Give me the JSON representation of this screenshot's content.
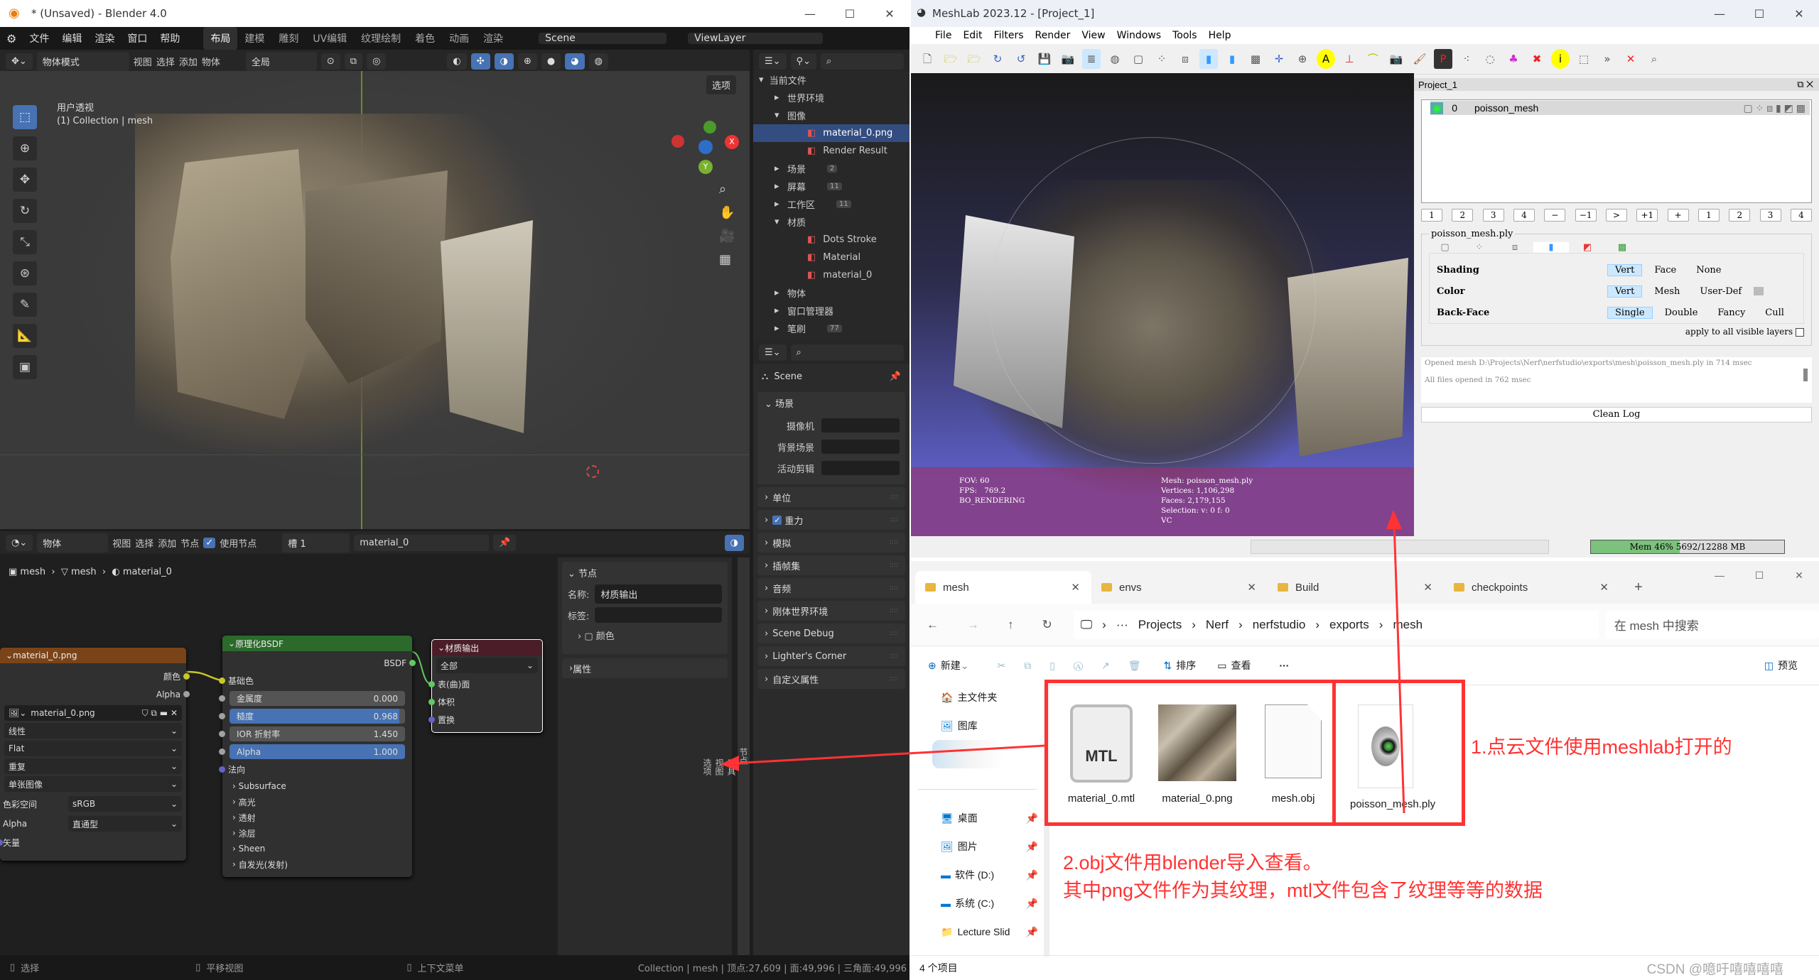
{
  "blender": {
    "title": "* (Unsaved) - Blender 4.0",
    "window_controls": [
      "—",
      "☐",
      "✕"
    ],
    "menu": [
      "文件",
      "编辑",
      "渲染",
      "窗口",
      "帮助"
    ],
    "workspaces": [
      "布局",
      "建模",
      "雕刻",
      "UV编辑",
      "纹理绘制",
      "着色",
      "动画",
      "渲染"
    ],
    "active_workspace": "布局",
    "scene": "Scene",
    "view_layer": "ViewLayer",
    "viewport_header": {
      "mode": "物体模式",
      "menus": [
        "视图",
        "选择",
        "添加",
        "物体"
      ],
      "orientation": "全局",
      "options": "选项"
    },
    "viewport_overlay": {
      "line1": "用户透视",
      "line2": "(1) Collection | mesh"
    },
    "outliner": {
      "root": "当前文件",
      "items": [
        {
          "label": "世界环境",
          "depth": 1,
          "expanded": false
        },
        {
          "label": "图像",
          "depth": 1,
          "expanded": true
        },
        {
          "label": "material_0.png",
          "depth": 2,
          "selected": true
        },
        {
          "label": "Render Result",
          "depth": 2
        },
        {
          "label": "场景",
          "depth": 1,
          "badge": "2"
        },
        {
          "label": "屏幕",
          "depth": 1,
          "badge": "11"
        },
        {
          "label": "工作区",
          "depth": 1,
          "badge": "11"
        },
        {
          "label": "材质",
          "depth": 1,
          "expanded": true
        },
        {
          "label": "Dots Stroke",
          "depth": 2
        },
        {
          "label": "Material",
          "depth": 2
        },
        {
          "label": "material_0",
          "depth": 2
        },
        {
          "label": "物体",
          "depth": 1
        },
        {
          "label": "窗口管理器",
          "depth": 1
        },
        {
          "label": "笔刷",
          "depth": 1,
          "badge": "77"
        }
      ]
    },
    "properties": {
      "context": "Scene",
      "scene_panel": "场景",
      "fields": [
        "摄像机",
        "背景场景",
        "活动剪辑"
      ],
      "panels": [
        "单位",
        "重力",
        "模拟",
        "插帧集",
        "音频",
        "刚体世界环境",
        "Scene Debug",
        "Lighter's Corner",
        "自定义属性"
      ],
      "gravity_checked": true
    },
    "node_header": {
      "type": "物体",
      "menus": [
        "视图",
        "选择",
        "添加",
        "节点"
      ],
      "use_nodes": "使用节点",
      "slot": "槽 1",
      "material": "material_0"
    },
    "breadcrumb": [
      "mesh",
      "mesh",
      "material_0"
    ],
    "image_node": {
      "title": "material_0.png",
      "outputs": [
        "颜色",
        "Alpha"
      ],
      "image": "material_0.png",
      "interp": "线性",
      "projection": "Flat",
      "extension": "重复",
      "source": "单张图像",
      "colorspace_label": "色彩空间",
      "colorspace": "sRGB",
      "alpha_label": "Alpha",
      "alpha": "直通型",
      "vector": "矢量"
    },
    "bsdf_node": {
      "title": "原理化BSDF",
      "output": "BSDF",
      "base_color": "基础色",
      "sliders": [
        {
          "label": "金属度",
          "value": "0.000",
          "fill": 0
        },
        {
          "label": "糙度",
          "value": "0.968",
          "fill": 0.968
        },
        {
          "label": "IOR 折射率",
          "value": "1.450",
          "fill": 0
        },
        {
          "label": "Alpha",
          "value": "1.000",
          "fill": 1
        }
      ],
      "normal": "法向",
      "subpanels": [
        "Subsurface",
        "高光",
        "透射",
        "涂层",
        "Sheen",
        "自发光(发射)"
      ]
    },
    "output_node": {
      "title": "材质输出",
      "target": "全部",
      "inputs": [
        "表(曲)面",
        "体积",
        "置换"
      ]
    },
    "node_sidebar": {
      "panel": "节点",
      "name_label": "名称:",
      "name": "材质输出",
      "label_label": "标签:",
      "color": "颜色",
      "props": "属性",
      "tabs": [
        "节点",
        "工具",
        "视图",
        "选项"
      ]
    },
    "status": {
      "select": "选择",
      "pan": "平移视图",
      "context": "上下文菜单",
      "stats": "Collection | mesh | 顶点:27,609 | 面:49,996 | 三角面:49,996"
    }
  },
  "meshlab": {
    "title": "MeshLab 2023.12 - [Project_1]",
    "menu": [
      "File",
      "Edit",
      "Filters",
      "Render",
      "View",
      "Windows",
      "Tools",
      "Help"
    ],
    "viewport_info": {
      "left": [
        "FOV: 60",
        "FPS:   769.2",
        "BO_RENDERING"
      ],
      "right": [
        "Mesh: poisson_mesh.ply",
        "Vertices: 1,106,298",
        "Faces: 2,179,155",
        "Selection: v: 0 f: 0",
        "VC"
      ]
    },
    "project": "Project_1",
    "layer": {
      "index": "0",
      "name": "poisson_mesh"
    },
    "layer_buttons": [
      "1",
      "2",
      "3",
      "4",
      "−",
      "−1",
      ">",
      "+1",
      "+",
      "1",
      "2",
      "3",
      "4"
    ],
    "mesh_file": "poisson_mesh.ply",
    "rows": [
      {
        "label": "Shading",
        "options": [
          "Vert",
          "Face",
          "None"
        ],
        "selected": "Vert"
      },
      {
        "label": "Color",
        "options": [
          "Vert",
          "Mesh",
          "User-Def"
        ],
        "selected": "Vert"
      },
      {
        "label": "Back-Face",
        "options": [
          "Single",
          "Double",
          "Fancy",
          "Cull"
        ],
        "selected": "Single"
      }
    ],
    "apply_all": "apply to all visible layers",
    "log": [
      "Opened mesh D:\\Projects\\Nerf\\nerfstudio\\exports\\mesh\\poisson_mesh.ply in 714 msec",
      "All files opened in 762 msec"
    ],
    "clean_log": "Clean Log",
    "mem": {
      "text": "Mem  46%  5692/12288 MB",
      "percent": 46
    }
  },
  "explorer": {
    "tabs": [
      "mesh",
      "envs",
      "Build",
      "checkpoints"
    ],
    "path": [
      "Projects",
      "Nerf",
      "nerfstudio",
      "exports",
      "mesh"
    ],
    "search_placeholder": "在 mesh 中搜索",
    "toolbar": {
      "new": "新建",
      "sort": "排序",
      "view": "查看",
      "more": "···",
      "preview": "预览"
    },
    "nav": [
      "主文件夹",
      "图库",
      "桌面",
      "图片",
      "软件 (D:)",
      "系统 (C:)",
      "Lecture Slid"
    ],
    "files": [
      "material_0.mtl",
      "material_0.png",
      "mesh.obj",
      "poisson_mesh.ply"
    ],
    "status": "4 个项目"
  },
  "annotations": {
    "note1": "1.点云文件使用meshlab打开的",
    "note2_line1": "2.obj文件用blender导入查看。",
    "note2_line2": "其中png文件作为其纹理，mtl文件包含了纹理等等的数据",
    "color": "#ff3333"
  },
  "watermark": "CSDN @噫吁嘻嘻嘻嘻"
}
